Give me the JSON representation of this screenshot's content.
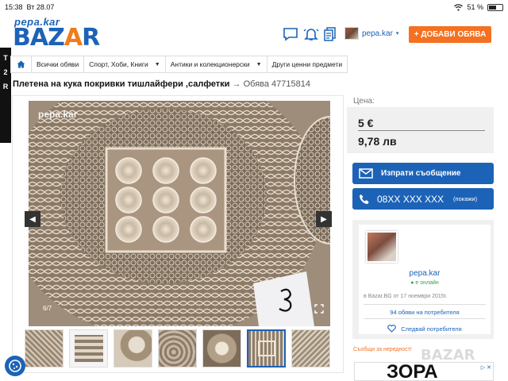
{
  "statusbar": {
    "time": "15:38",
    "date": "Вт 28.07",
    "battery": "51 %"
  },
  "header": {
    "logo_top": "pepa.kar",
    "logo_main_1": "BAZ",
    "logo_main_a": "A",
    "logo_main_2": "R",
    "username": "pepa.kar",
    "add_button": "+ ДОБАВИ ОБЯВА"
  },
  "breadcrumb": [
    "Всички обяви",
    "Спорт, Хоби, Книги",
    "Антики и колекционерски",
    "Други ценни предмети"
  ],
  "listing": {
    "title": "Плетена на кука покривки тишлайфери ,салфетки",
    "arrow": "→",
    "ad_id": "Обява 47715814"
  },
  "gallery": {
    "watermark": "pepa.kar",
    "counter": "6/7"
  },
  "price": {
    "label": "Цена:",
    "eur": "5 €",
    "bgn": "9,78 лв"
  },
  "actions": {
    "message": "Изпрати съобщение",
    "phone": "08XX XXX XXX",
    "phone_show": "(покажи)"
  },
  "seller": {
    "name": "pepa.kar",
    "status": "● е онлайн",
    "since": "в Bazar.BG от 17 ноември 2015г.",
    "ads_link": "94 обяви на потребителя",
    "follow": "Следвай потребителя"
  },
  "report": "Съобщи за нередност!",
  "side_ad": {
    "line1": "T",
    "line2": "2",
    "line3": "R"
  },
  "bottom_ad": {
    "brand": "ЗОРА",
    "flag": "▷ ✕"
  },
  "watermark_logo": "BAZAR",
  "colors": {
    "brand_blue": "#1c63b7",
    "accent_orange": "#f37121"
  }
}
